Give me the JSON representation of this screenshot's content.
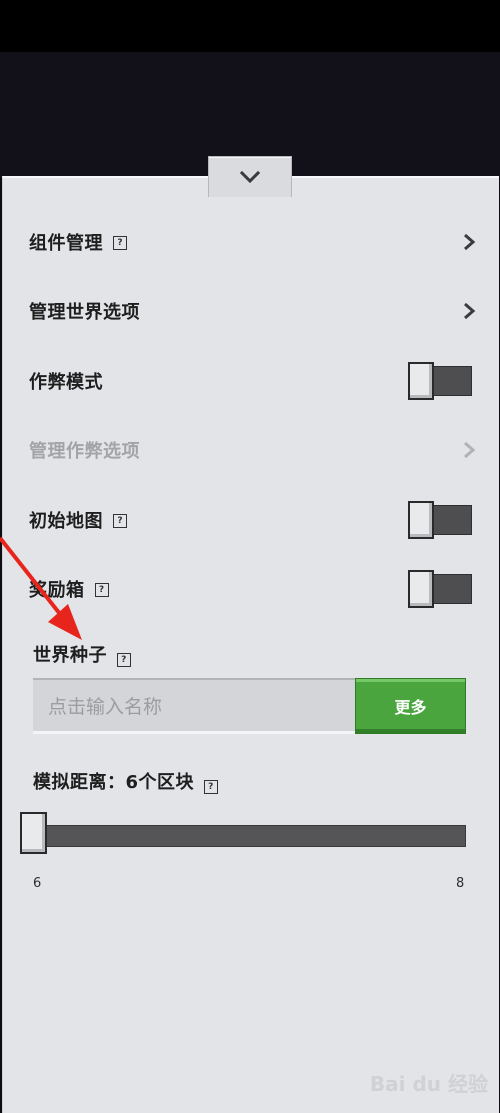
{
  "menu": {
    "items": [
      {
        "label": "组件管理",
        "help": true,
        "control": "chevron"
      },
      {
        "label": "管理世界选项",
        "help": false,
        "control": "chevron"
      },
      {
        "label": "作弊模式",
        "help": false,
        "control": "toggle",
        "on": false
      },
      {
        "label": "管理作弊选项",
        "help": false,
        "control": "chevron",
        "disabled": true
      },
      {
        "label": "初始地图",
        "help": true,
        "control": "toggle",
        "on": false
      },
      {
        "label": "奖励箱",
        "help": true,
        "control": "toggle",
        "on": false
      }
    ]
  },
  "seed": {
    "label": "世界种子",
    "placeholder": "点击输入名称",
    "more_label": "更多"
  },
  "render_distance": {
    "label": "模拟距离：6个区块",
    "value": 6,
    "min": 6,
    "max": 8,
    "min_label": "6",
    "max_label": "8"
  },
  "watermark": "Bai du 经验",
  "colors": {
    "accent_green": "#4aa53e",
    "annotation_arrow": "#e8251c"
  }
}
